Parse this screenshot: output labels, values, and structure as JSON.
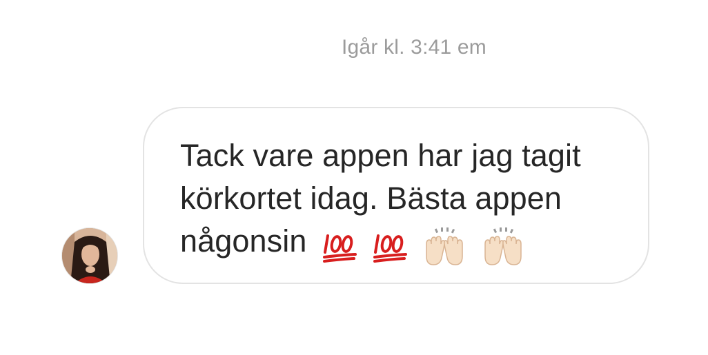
{
  "thread": {
    "timestamp": "Igår kl. 3:41 em"
  },
  "message": {
    "sender_avatar_icon": "avatar-photo-icon",
    "line1": "Tack vare appen har jag tagit",
    "line2": "körkortet idag. Bästa appen",
    "line3": "någonsin",
    "emojis": [
      "hundred-points-icon",
      "hundred-points-icon",
      "raising-hands-icon",
      "raising-hands-icon"
    ]
  },
  "colors": {
    "timestamp": "#9b9b9b",
    "text": "#262626",
    "bubble_border": "#e3e3e3",
    "hundred_red": "#d81e1e"
  }
}
